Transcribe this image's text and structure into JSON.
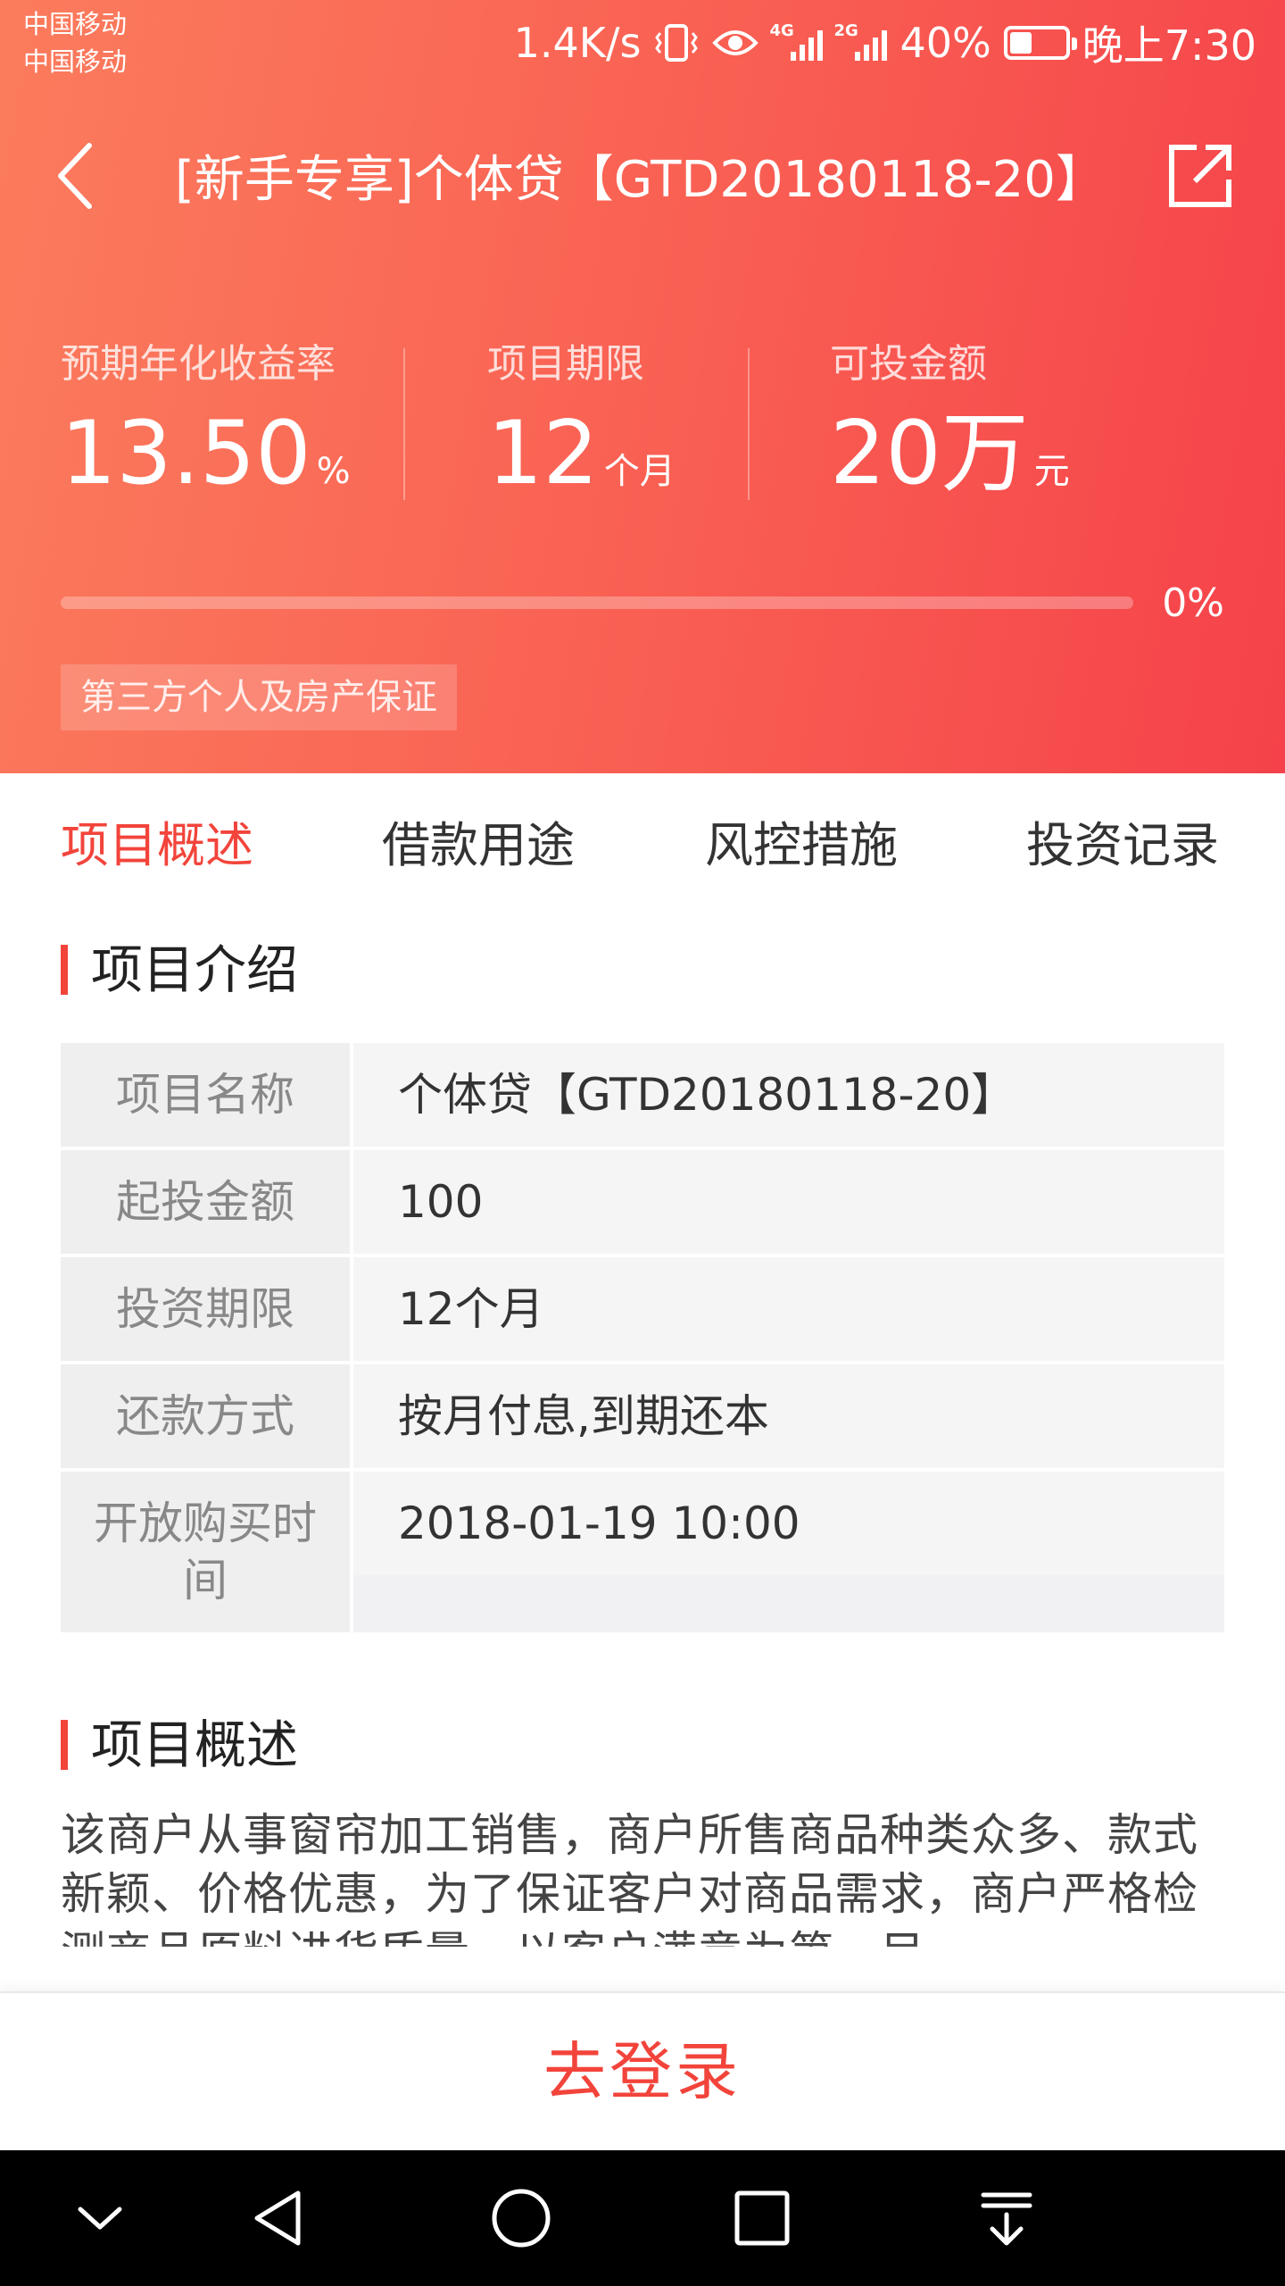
{
  "status_bar": {
    "carrier_1": "中国移动",
    "carrier_2": "中国移动",
    "net_speed": "1.4K/s",
    "signal_1_tag": "4G",
    "signal_2_tag": "2G",
    "battery_percent": "40%",
    "battery_level": 0.4,
    "time": "晚上7:30"
  },
  "navbar": {
    "title": "[新手专享]个体贷【GTD20180118-20】",
    "back_icon": "chevron-left-icon",
    "share_icon": "share-external-icon"
  },
  "stats": {
    "rate_label": "预期年化收益率",
    "rate_value": "13.50",
    "rate_unit": "%",
    "term_label": "项目期限",
    "term_value": "12",
    "term_unit": "个月",
    "amount_label": "可投金额",
    "amount_value": "20万",
    "amount_unit": "元"
  },
  "progress": {
    "value": 0,
    "label": "0%"
  },
  "guarantee_tag": "第三方个人及房产保证",
  "colors": {
    "accent": "#f2443b",
    "header_start": "#fb7c5d",
    "header_end": "#f5424a"
  },
  "tabs": [
    {
      "label": "项目概述",
      "active": true
    },
    {
      "label": "借款用途",
      "active": false
    },
    {
      "label": "风控措施",
      "active": false
    },
    {
      "label": "投资记录",
      "active": false
    }
  ],
  "intro_section": {
    "title": "项目介绍",
    "rows": [
      {
        "key": "项目名称",
        "value": "个体贷【GTD20180118-20】"
      },
      {
        "key": "起投金额",
        "value": "100"
      },
      {
        "key": "投资期限",
        "value": "12个月"
      },
      {
        "key": "还款方式",
        "value": "按月付息,到期还本"
      },
      {
        "key": "开放购买时间",
        "value": "2018-01-19 10:00"
      }
    ]
  },
  "overview_section": {
    "title": "项目概述",
    "text": "该商户从事窗帘加工销售，商户所售商品种类众多、款式新颖、价格优惠，为了保证客户对商品需求，商户严格检测商品原料进货质量，以客户满意为第一目"
  },
  "login_button": "去登录",
  "system_nav": {
    "icons": [
      "chevron-down-icon",
      "back-triangle-icon",
      "home-circle-icon",
      "recents-square-icon",
      "notification-pull-icon"
    ]
  }
}
